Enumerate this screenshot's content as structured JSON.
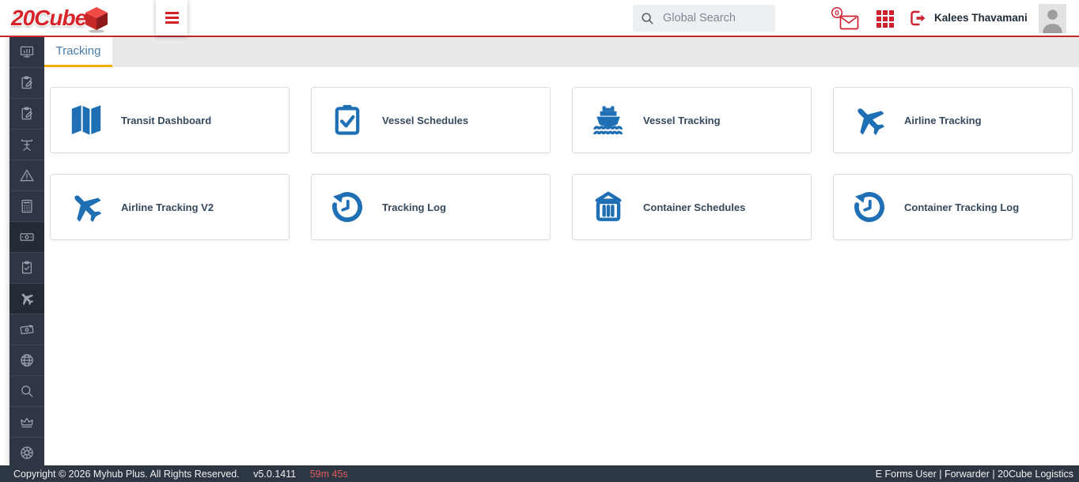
{
  "header": {
    "logo_text": "20Cube",
    "search_placeholder": "Global Search",
    "mail_badge_count": "0",
    "user_name": "Kalees Thavamani"
  },
  "tab_bar": {
    "tabs": [
      {
        "label": "Tracking",
        "active": true
      }
    ]
  },
  "sidebar": {
    "items": [
      {
        "icon": "dashboard-monitor-icon",
        "active": false
      },
      {
        "icon": "clipboard-edit-icon",
        "active": false
      },
      {
        "icon": "clipboard-edit-2-icon",
        "active": false
      },
      {
        "icon": "port-crane-icon",
        "active": false
      },
      {
        "icon": "warning-triangle-icon",
        "active": false
      },
      {
        "icon": "calculator-icon",
        "active": false
      },
      {
        "icon": "banknote-icon",
        "active": true
      },
      {
        "icon": "clipboard-check-icon",
        "active": false
      },
      {
        "icon": "plane-icon",
        "active": true
      },
      {
        "icon": "invoice-money-icon",
        "active": false
      },
      {
        "icon": "globe-icon",
        "active": false
      },
      {
        "icon": "search-icon",
        "active": false
      },
      {
        "icon": "crown-icon",
        "active": false
      },
      {
        "icon": "wheel-icon",
        "active": false
      }
    ]
  },
  "main": {
    "cards": [
      {
        "label": "Transit Dashboard",
        "icon": "map-icon"
      },
      {
        "label": "Vessel Schedules",
        "icon": "clipboard-check-icon"
      },
      {
        "label": "Vessel Tracking",
        "icon": "ship-icon"
      },
      {
        "label": "Airline Tracking",
        "icon": "plane-icon"
      },
      {
        "label": "Airline Tracking V2",
        "icon": "plane-icon"
      },
      {
        "label": "Tracking Log",
        "icon": "history-icon"
      },
      {
        "label": "Container Schedules",
        "icon": "container-icon"
      },
      {
        "label": "Container Tracking Log",
        "icon": "history-icon"
      }
    ]
  },
  "footer": {
    "copyright": "Copyright © 2026 Myhub Plus. All Rights Reserved.",
    "version": "v5.0.1411",
    "session_timer": "59m 45s",
    "right_text": "E Forms User | Forwarder | 20Cube Logistics"
  },
  "colors": {
    "brand_red": "#d6252b",
    "header_border": "#c7262b",
    "icon_red": "#cf2030",
    "card_icon_blue": "#1e6fb4",
    "tab_text": "#4a7ba7",
    "tab_underline": "#efae00",
    "sidebar_bg": "#2d3642",
    "sidebar_active_bg": "#232b35",
    "sidebar_icon": "#9aa3b0",
    "footer_bg": "#2d3744",
    "timer_red": "#e05d5d"
  }
}
